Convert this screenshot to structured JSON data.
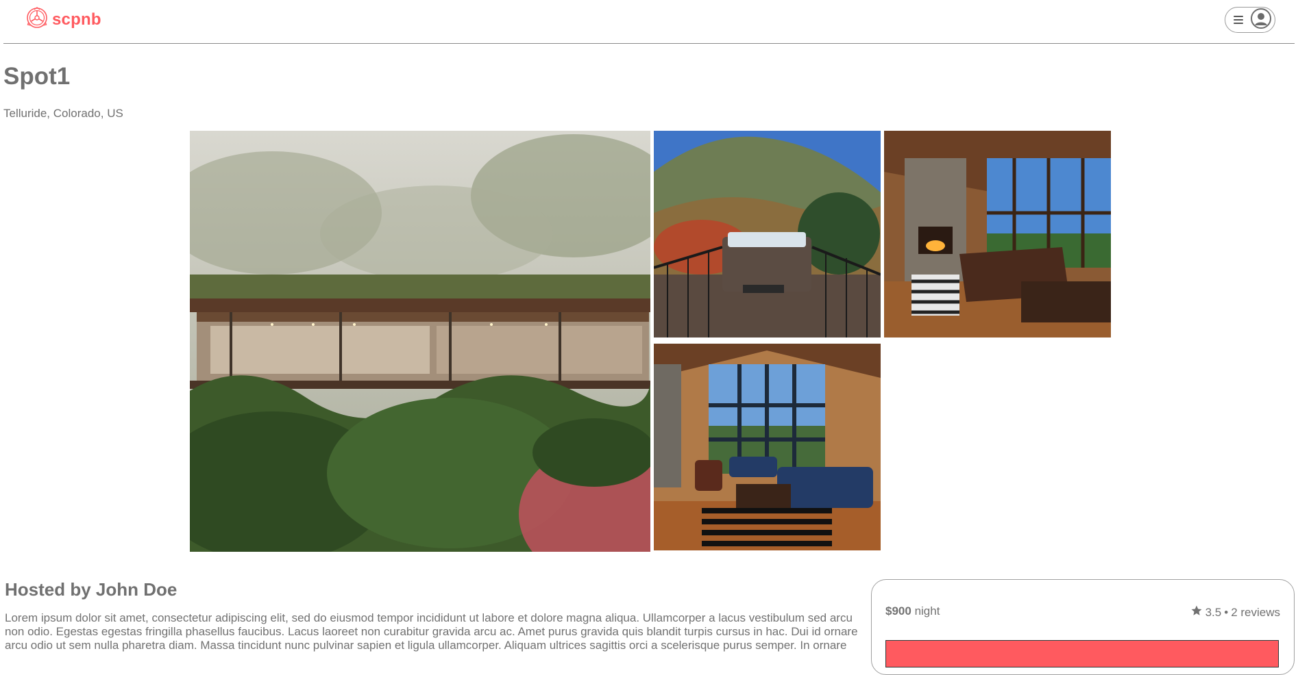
{
  "header": {
    "logo_text": "scpnb",
    "logo_icon": "scp-logo-icon",
    "menu_icon": "hamburger-icon",
    "avatar_icon": "user-avatar-icon"
  },
  "spot": {
    "title": "Spot1",
    "location": "Telluride, Colorado, US"
  },
  "gallery": {
    "images": [
      {
        "name": "main-photo",
        "subject": "modern house in jungle"
      },
      {
        "name": "hot-tub-deck-photo",
        "subject": "hot tub on mountain deck"
      },
      {
        "name": "living-room-fireplace-photo",
        "subject": "cabin living room with fireplace"
      },
      {
        "name": "living-room-windows-photo",
        "subject": "cabin living room with tall windows"
      }
    ]
  },
  "host": {
    "heading": "Hosted by John Doe",
    "description": "Lorem ipsum dolor sit amet, consectetur adipiscing elit, sed do eiusmod tempor incididunt ut labore et dolore magna aliqua. Ullamcorper a lacus vestibulum sed arcu non odio. Egestas egestas fringilla phasellus faucibus. Lacus laoreet non curabitur gravida arcu ac. Amet purus gravida quis blandit turpis cursus in hac. Dui id ornare arcu odio ut sem nulla pharetra diam. Massa tincidunt nunc pulvinar sapien et ligula ullamcorper. Aliquam ultrices sagittis orci a scelerisque purus semper. In ornare"
  },
  "booking": {
    "price": "$900",
    "price_unit": "night",
    "star_icon": "star-icon",
    "rating": "3.5",
    "separator": "•",
    "reviews": "2 reviews",
    "reserve_label": "",
    "colors": {
      "brand": "#ff5a5f"
    }
  }
}
